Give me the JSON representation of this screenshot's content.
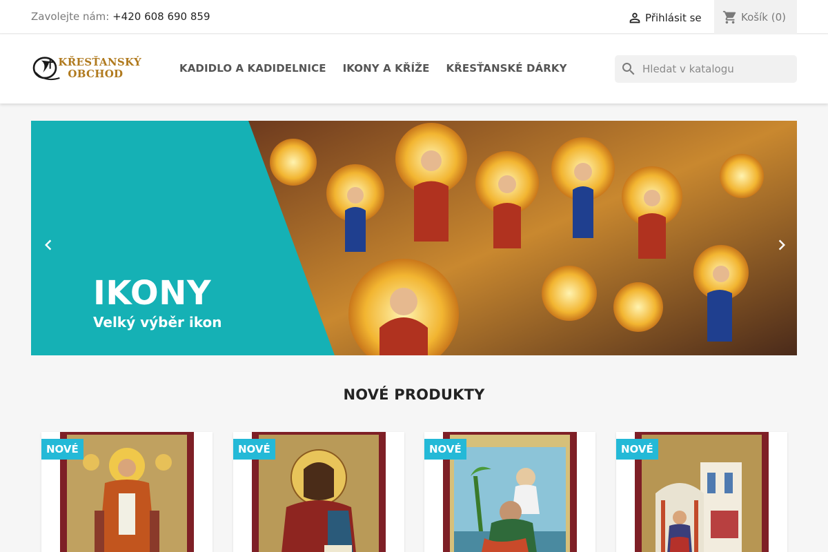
{
  "topbar": {
    "contact_label": "Zavolejte nám:",
    "phone": "+420 608 690 859",
    "login_label": "Přihlásit se",
    "cart_label": "Košík",
    "cart_count": "(0)"
  },
  "header": {
    "logo_line1": "KŘESŤANSKÝ",
    "logo_line2": "OBCHOD",
    "nav": [
      "KADIDLO A KADIDELNICE",
      "IKONY A KŘÍŽE",
      "KŘESŤANSKÉ DÁRKY"
    ],
    "search_placeholder": "Hledat v katalogu"
  },
  "carousel": {
    "title": "IKONY",
    "subtitle": "Velký výběr ikon",
    "accent_color": "#15b1b5"
  },
  "section": {
    "title": "NOVÉ PRODUKTY"
  },
  "products": [
    {
      "badge": "NOVÉ"
    },
    {
      "badge": "NOVÉ"
    },
    {
      "badge": "NOVÉ"
    },
    {
      "badge": "NOVÉ"
    }
  ],
  "colors": {
    "badge": "#24b9d7",
    "frame": "#7e1f26"
  }
}
